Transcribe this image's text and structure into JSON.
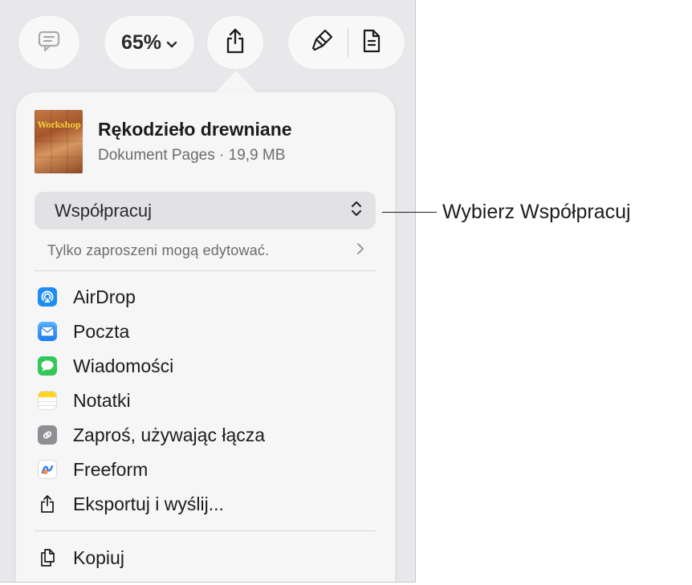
{
  "toolbar": {
    "comment_icon": "speech-bubble-icon",
    "zoom_label": "65%",
    "zoom_icon": "chevron-down-icon",
    "share_icon": "share-icon",
    "format_icon": "paintbrush-icon",
    "document_icon": "document-icon"
  },
  "document": {
    "thumbnail_text": "Workshop",
    "title": "Rękodzieło drewniane",
    "meta": "Dokument Pages · 19,9 MB"
  },
  "collaboration": {
    "mode_label": "Współpracuj",
    "mode_icon": "up-down-chevron-icon",
    "permission_label": "Tylko zaproszeni mogą edytować.",
    "permission_icon": "chevron-right-icon"
  },
  "menu": {
    "items": [
      {
        "label": "AirDrop",
        "icon": "airdrop-icon",
        "color": "#1f8cf4"
      },
      {
        "label": "Poczta",
        "icon": "mail-icon",
        "color": "#2a8cf3"
      },
      {
        "label": "Wiadomości",
        "icon": "messages-icon",
        "color": "#34c759"
      },
      {
        "label": "Notatki",
        "icon": "notes-icon",
        "color": "#ffd426"
      },
      {
        "label": "Zaproś, używając łącza",
        "icon": "link-icon",
        "color": "#8e8e93"
      },
      {
        "label": "Freeform",
        "icon": "freeform-icon",
        "color": "#ffffff"
      },
      {
        "label": "Eksportuj i wyślij...",
        "icon": "export-icon",
        "color": "#1c1c1e"
      },
      {
        "label": "Kopiuj",
        "icon": "copy-icon",
        "color": "#1c1c1e"
      }
    ]
  },
  "callout": {
    "text": "Wybierz Współpracuj"
  }
}
